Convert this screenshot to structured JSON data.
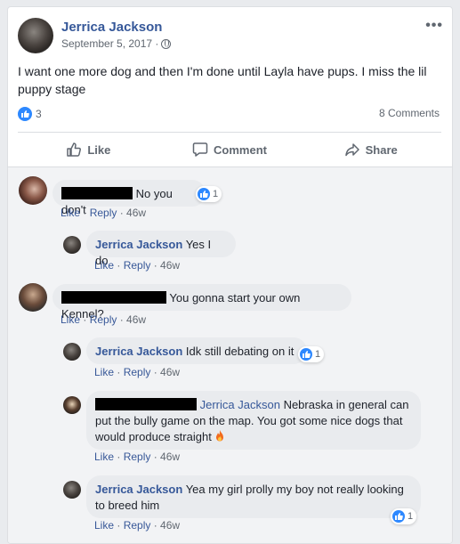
{
  "post": {
    "author": "Jerrica Jackson",
    "date": "September 5, 2017 ·",
    "text": "I want one more dog and then I'm done until Layla have pups. I miss the lil puppy stage",
    "reaction_count": "3",
    "comments_count": "8 Comments"
  },
  "actions": {
    "like": "Like",
    "comment": "Comment",
    "share": "Share"
  },
  "comments": [
    {
      "text": "No you don't",
      "reactions": "1",
      "meta": {
        "like": "Like",
        "reply": "Reply",
        "age": "46w"
      }
    },
    {
      "author": "Jerrica Jackson",
      "text": "Yes I do",
      "meta": {
        "like": "Like",
        "reply": "Reply",
        "age": "46w"
      }
    },
    {
      "text": "You gonna start your own Kennel?",
      "meta": {
        "like": "Like",
        "reply": "Reply",
        "age": "46w"
      }
    },
    {
      "author": "Jerrica Jackson",
      "text": "Idk still debating on it",
      "reactions": "1",
      "meta": {
        "like": "Like",
        "reply": "Reply",
        "age": "46w"
      }
    },
    {
      "tag": "Jerrica Jackson",
      "text": "Nebraska in general can put the bully game on the map. You got some nice dogs that would produce straight",
      "meta": {
        "like": "Like",
        "reply": "Reply",
        "age": "46w"
      }
    },
    {
      "author": "Jerrica Jackson",
      "text": "Yea my girl prolly my boy not really looking to breed him",
      "reactions": "1",
      "meta": {
        "like": "Like",
        "reply": "Reply",
        "age": "46w"
      }
    }
  ],
  "colors": {
    "link": "#365899",
    "like_blue": "#2d88ff",
    "bubble": "#e9ebee",
    "comments_bg": "#f2f3f5"
  }
}
